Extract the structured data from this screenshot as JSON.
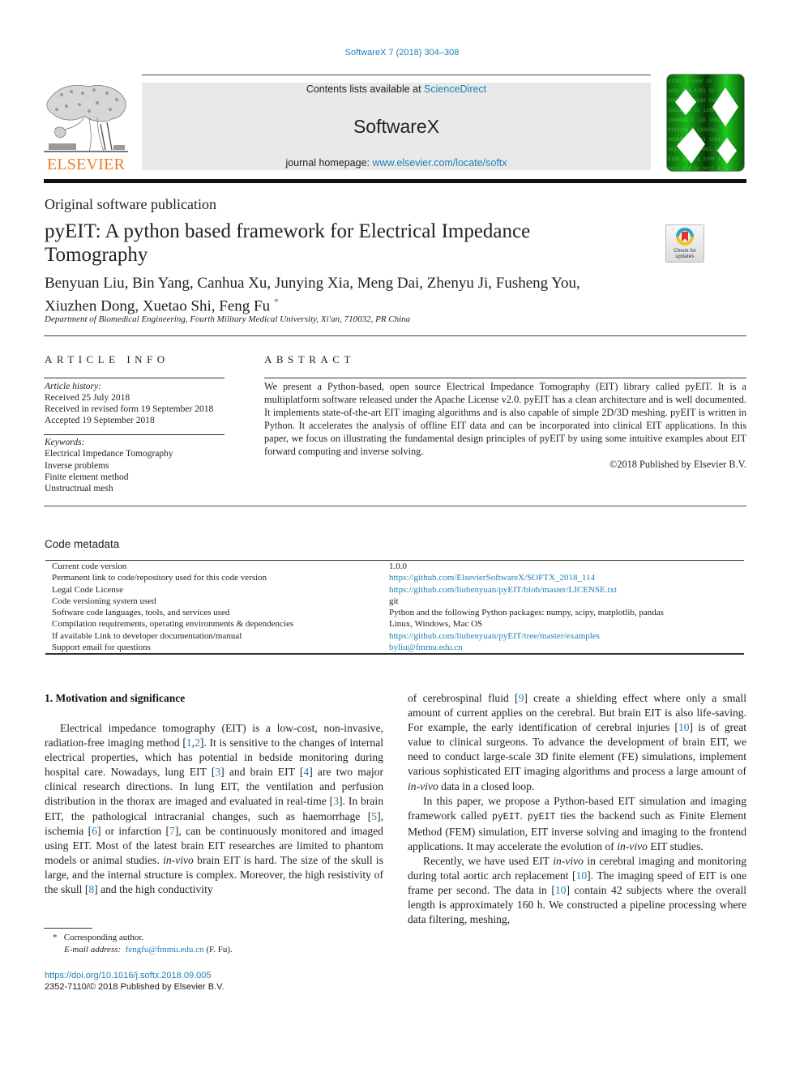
{
  "header": {
    "journal_ref": "SoftwareX 7 (2018) 304–308",
    "contents_prefix": "Contents lists available at ",
    "contents_link": "ScienceDirect",
    "journal_name": "SoftwareX",
    "homepage_prefix": "journal homepage: ",
    "homepage_link": "www.elsevier.com/locate/softx",
    "publisher_logo_text": "ELSEVIER",
    "publisher_logo_color": "#f07c22",
    "link_color": "#1d7fb5"
  },
  "article": {
    "publication_type": "Original software publication",
    "title": "pyEIT: A python based framework for Electrical Impedance Tomography",
    "crossmark_label": "Check for updates",
    "authors_line1": "Benyuan Liu, Bin Yang, Canhua Xu, Junying Xia, Meng Dai, Zhenyu Ji, Fusheng You,",
    "authors_line2": "Xiuzhen Dong, Xuetao Shi, Feng Fu",
    "corresponding_mark": "*",
    "affiliation": "Department of Biomedical Engineering, Fourth Military Medical University, Xi'an, 710032, PR China"
  },
  "article_info": {
    "heading": "ARTICLE INFO",
    "history_label": "Article history:",
    "history": [
      "Received 25 July 2018",
      "Received in revised form 19 September 2018",
      "Accepted 19 September 2018"
    ],
    "keywords_label": "Keywords:",
    "keywords": [
      "Electrical Impedance Tomography",
      "Inverse problems",
      "Finite element method",
      "Unstructrual mesh"
    ]
  },
  "abstract": {
    "heading": "ABSTRACT",
    "text": "We present a Python-based, open source Electrical Impedance Tomography (EIT) library called pyEIT. It is a multiplatform software released under the Apache License v2.0. pyEIT has a clean architecture and is well documented. It implements state-of-the-art EIT imaging algorithms and is also capable of simple 2D/3D meshing. pyEIT is written in Python. It accelerates the analysis of offline EIT data and can be incorporated into clinical EIT applications. In this paper, we focus on illustrating the fundamental design principles of pyEIT by using some intuitive examples about EIT forward computing and inverse solving.",
    "copyright": "©2018 Published by Elsevier B.V."
  },
  "code_metadata": {
    "title": "Code metadata",
    "rows": [
      {
        "label": "Current code version",
        "value": "1.0.0",
        "is_link": false
      },
      {
        "label": "Permanent link to code/repository used for this code version",
        "value": "https://github.com/ElsevierSoftwareX/SOFTX_2018_114",
        "is_link": true
      },
      {
        "label": "Legal Code License",
        "value": "https://github.com/liubenyuan/pyEIT/blob/master/LICENSE.txt",
        "is_link": true
      },
      {
        "label": "Code versioning system used",
        "value": "git",
        "is_link": false
      },
      {
        "label": "Software code languages, tools, and services used",
        "value": "Python and the following Python packages: numpy, scipy, matplotlib, pandas",
        "is_link": false
      },
      {
        "label": "Compilation requirements, operating environments & dependencies",
        "value": "Linux, Windows, Mac OS",
        "is_link": false
      },
      {
        "label": "If available Link to developer documentation/manual",
        "value": "https://github.com/liubenyuan/pyEIT/tree/master/examples",
        "is_link": true
      },
      {
        "label": "Support email for questions",
        "value": "byliu@fmmu.edu.cn",
        "is_link": true
      }
    ]
  },
  "body": {
    "section_heading": "1.  Motivation and significance",
    "left_p1": [
      {
        "t": "Electrical impedance tomography (EIT) is a low-cost, non-invasive, radiation-free imaging method ["
      },
      {
        "t": "1",
        "ref": true
      },
      {
        "t": ","
      },
      {
        "t": "2",
        "ref": true
      },
      {
        "t": "]. It is sensitive to the changes of internal electrical properties, which has potential in bedside monitoring during hospital care. Nowadays, lung EIT ["
      },
      {
        "t": "3",
        "ref": true
      },
      {
        "t": "] and brain EIT ["
      },
      {
        "t": "4",
        "ref": true
      },
      {
        "t": "] are two major clinical research directions. In lung EIT, the ventilation and perfusion distribution in the thorax are imaged and evaluated in real-time ["
      },
      {
        "t": "3",
        "ref": true
      },
      {
        "t": "]. In brain EIT, the pathological intracranial changes, such as haemorrhage ["
      },
      {
        "t": "5",
        "ref": true
      },
      {
        "t": "], ischemia ["
      },
      {
        "t": "6",
        "ref": true
      },
      {
        "t": "] or infarction ["
      },
      {
        "t": "7",
        "ref": true
      },
      {
        "t": "], can be continuously monitored and imaged using EIT. Most of the latest brain EIT researches are limited to phantom models or animal studies. "
      },
      {
        "t": "in-vivo",
        "italic": true
      },
      {
        "t": " brain EIT is hard. The size of the skull is large, and the internal structure is complex. Moreover, the high resistivity of the skull ["
      },
      {
        "t": "8",
        "ref": true
      },
      {
        "t": "] and the  high conductivity"
      }
    ],
    "right_p0": [
      {
        "t": "of cerebrospinal fluid ["
      },
      {
        "t": "9",
        "ref": true
      },
      {
        "t": "] create a shielding effect where only a small amount of current applies on the cerebral. But brain EIT is also life-saving. For example, the early identification of cerebral injuries ["
      },
      {
        "t": "10",
        "ref": true
      },
      {
        "t": "] is of great value to clinical surgeons. To advance the development of brain EIT, we need to conduct large-scale 3D finite element (FE) simulations, implement various sophisticated EIT imaging algorithms and process a large amount of "
      },
      {
        "t": "in-vivo",
        "italic": true
      },
      {
        "t": " data in a closed loop."
      }
    ],
    "right_p1": [
      {
        "t": "In this paper, we propose a Python-based EIT simulation and imaging framework called "
      },
      {
        "t": "pyEIT",
        "mono": true
      },
      {
        "t": ". "
      },
      {
        "t": "pyEIT",
        "mono": true
      },
      {
        "t": " ties the backend such as Finite Element Method (FEM) simulation, EIT inverse solving and imaging to the frontend applications. It may accelerate the evolution of "
      },
      {
        "t": "in-vivo",
        "italic": true
      },
      {
        "t": " EIT studies."
      }
    ],
    "right_p2": [
      {
        "t": "Recently, we have used EIT "
      },
      {
        "t": "in-vivo",
        "italic": true
      },
      {
        "t": " in cerebral imaging and monitoring during total aortic arch replacement ["
      },
      {
        "t": "10",
        "ref": true
      },
      {
        "t": "]. The imaging speed of EIT is one frame per second. The data in ["
      },
      {
        "t": "10",
        "ref": true
      },
      {
        "t": "] contain 42 subjects where the overall length is approximately 160 h. We constructed a pipeline processing where data filtering, meshing,"
      }
    ]
  },
  "footnotes": {
    "star": "*",
    "corresponding": "Corresponding author.",
    "email_label": "E-mail address:",
    "email": "fengfu@fmmu.edu.cn",
    "email_suffix": " (F. Fu).",
    "doi": "https://doi.org/10.1016/j.softx.2018.09.005",
    "issn_line": "2352-7110/© 2018 Published by Elsevier B.V."
  }
}
